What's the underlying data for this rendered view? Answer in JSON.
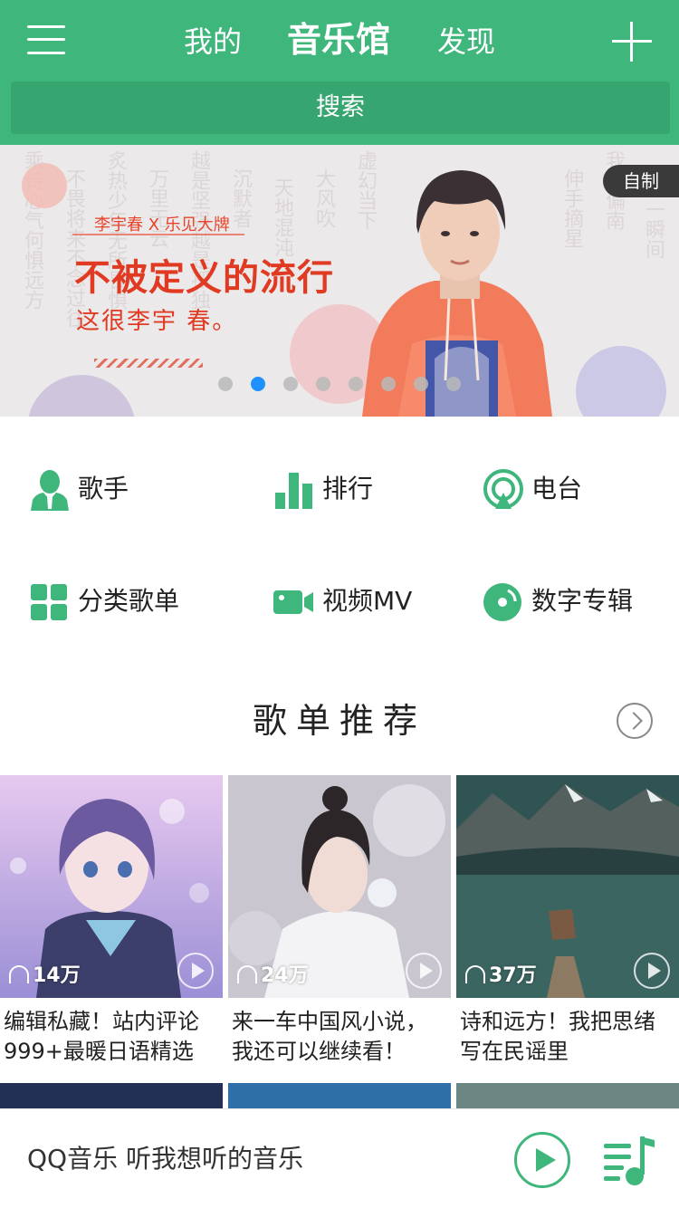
{
  "header": {
    "tabs": [
      "我的",
      "音乐馆",
      "发现"
    ],
    "search_label": "搜索",
    "colors": {
      "bar": "#3fb67b",
      "search": "#36a56f"
    }
  },
  "banner": {
    "subtitle": "李宇春 X 乐见大牌",
    "title": "不被定义的流行",
    "slogan": "这很李宇 春。",
    "badge": "自制",
    "background_text": [
      "乘诗心气何惧远方",
      "不畏将来不念过往",
      "炙热少年无所畏惧",
      "万里无云",
      "越是坚强越是孤独",
      "沉默者",
      "天地混沌",
      "大风吹",
      "虚幻当下",
      "伸手摘星",
      "我乡偏南",
      "一瞬间"
    ],
    "dot_count": 8,
    "active_dot": 1
  },
  "quick_nav": [
    {
      "label": "歌手",
      "icon": "singer-icon"
    },
    {
      "label": "排行",
      "icon": "chart-icon"
    },
    {
      "label": "电台",
      "icon": "radio-icon"
    },
    {
      "label": "分类歌单",
      "icon": "category-icon"
    },
    {
      "label": "视频MV",
      "icon": "video-icon"
    },
    {
      "label": "数字专辑",
      "icon": "album-icon"
    }
  ],
  "section": {
    "title": "歌单推荐"
  },
  "playlists": [
    {
      "plays": "14万",
      "title": "编辑私藏！站内评论999+最暖日语精选"
    },
    {
      "plays": "24万",
      "title": "来一车中国风小说，我还可以继续看！"
    },
    {
      "plays": "37万",
      "title": "诗和远方！我把思绪写在民谣里"
    }
  ],
  "player": {
    "text": "QQ音乐 听我想听的音乐",
    "accent": "#3fb67b"
  }
}
